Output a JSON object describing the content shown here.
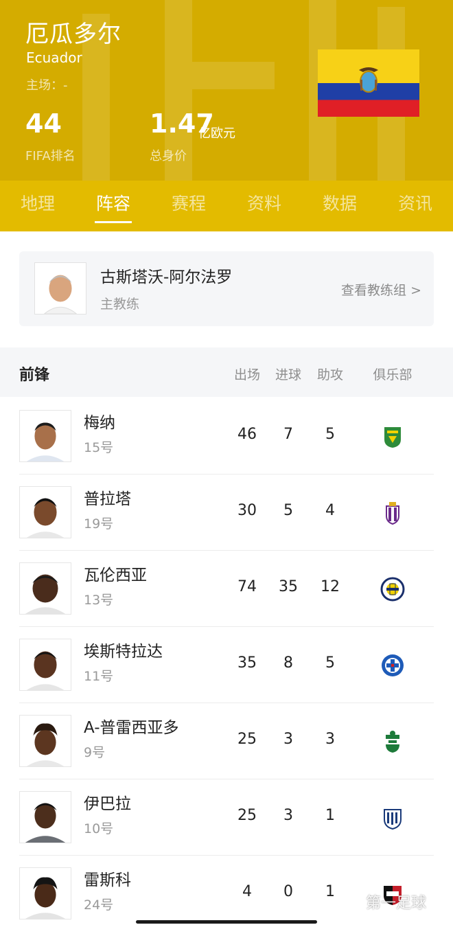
{
  "team": {
    "name_cn": "厄瓜多尔",
    "name_en": "Ecuador",
    "home": "主场：-",
    "fifa_rank_value": "44",
    "fifa_rank_label": "FIFA排名",
    "value_number": "1.47",
    "value_unit": "亿欧元",
    "value_label": "总身价"
  },
  "tabs": [
    {
      "label": "地理"
    },
    {
      "label": "阵容"
    },
    {
      "label": "赛程"
    },
    {
      "label": "资料"
    },
    {
      "label": "数据"
    },
    {
      "label": "资讯"
    }
  ],
  "active_tab": "阵容",
  "coach": {
    "name": "古斯塔沃-阿尔法罗",
    "role": "主教练",
    "link": "查看教练组 >"
  },
  "section": {
    "title": "前锋",
    "columns": [
      "出场",
      "进球",
      "助攻",
      "俱乐部"
    ]
  },
  "players": [
    {
      "name": "梅纳",
      "number": "15号",
      "apps": "46",
      "goals": "7",
      "assists": "5",
      "club_icon": "leon-badge-icon"
    },
    {
      "name": "普拉塔",
      "number": "19号",
      "apps": "30",
      "goals": "5",
      "assists": "4",
      "club_icon": "valladolid-badge-icon"
    },
    {
      "name": "瓦伦西亚",
      "number": "13号",
      "apps": "74",
      "goals": "35",
      "assists": "12",
      "club_icon": "fenerbahce-badge-icon"
    },
    {
      "name": "埃斯特拉达",
      "number": "11号",
      "apps": "35",
      "goals": "8",
      "assists": "5",
      "club_icon": "cruz-azul-badge-icon"
    },
    {
      "name": "A-普雷西亚多",
      "number": "9号",
      "apps": "25",
      "goals": "3",
      "assists": "3",
      "club_icon": "santos-laguna-badge-icon"
    },
    {
      "name": "伊巴拉",
      "number": "10号",
      "apps": "25",
      "goals": "3",
      "assists": "1",
      "club_icon": "pachuca-badge-icon"
    },
    {
      "name": "雷斯科",
      "number": "24号",
      "apps": "4",
      "goals": "0",
      "assists": "1",
      "club_icon": "newells-badge-icon"
    }
  ],
  "watermark": "第一足球",
  "colors": {
    "header_bg": "#d4ac00",
    "tabs_bg": "#e3bb00",
    "flag_yellow": "#f7d117",
    "flag_blue": "#1f3fa6",
    "flag_red": "#e01f26"
  }
}
